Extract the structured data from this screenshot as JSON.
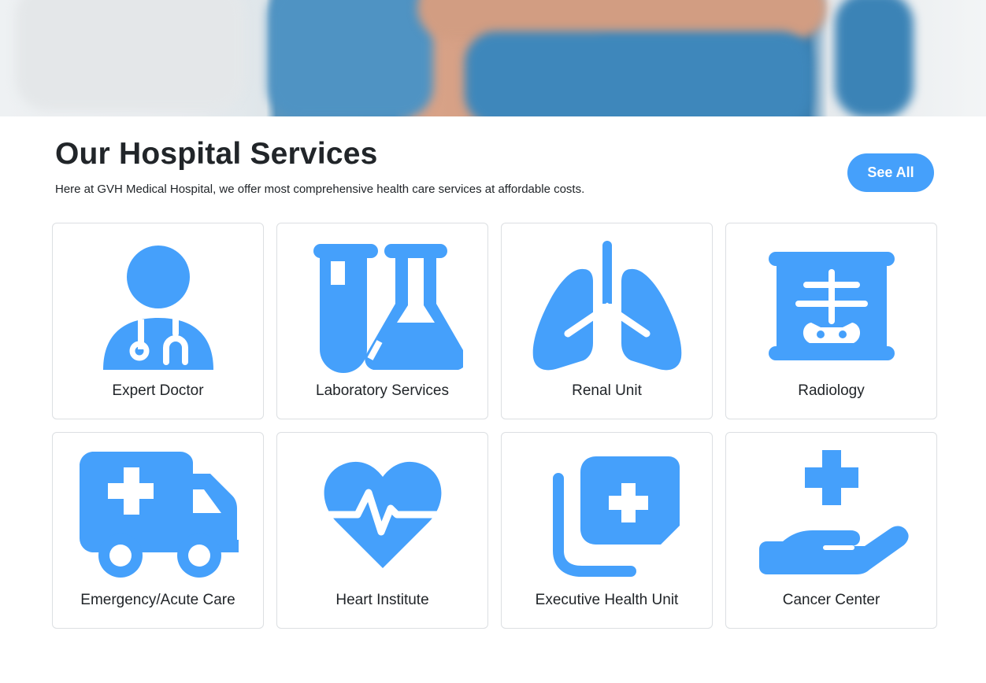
{
  "section": {
    "title": "Our Hospital Services",
    "subtitle": "Here at GVH Medical Hospital, we offer most comprehensive health care services at affordable costs.",
    "see_all_label": "See All"
  },
  "accent_color": "#45a0fb",
  "services": [
    {
      "label": "Expert Doctor",
      "icon": "doctor-icon"
    },
    {
      "label": "Laboratory Services",
      "icon": "lab-flask-icon"
    },
    {
      "label": "Renal Unit",
      "icon": "lungs-icon"
    },
    {
      "label": "Radiology",
      "icon": "xray-icon"
    },
    {
      "label": "Emergency/Acute Care",
      "icon": "ambulance-icon"
    },
    {
      "label": "Heart Institute",
      "icon": "heart-pulse-icon"
    },
    {
      "label": "Executive Health Unit",
      "icon": "medical-file-icon"
    },
    {
      "label": "Cancer Center",
      "icon": "hand-holding-medical-icon"
    }
  ]
}
